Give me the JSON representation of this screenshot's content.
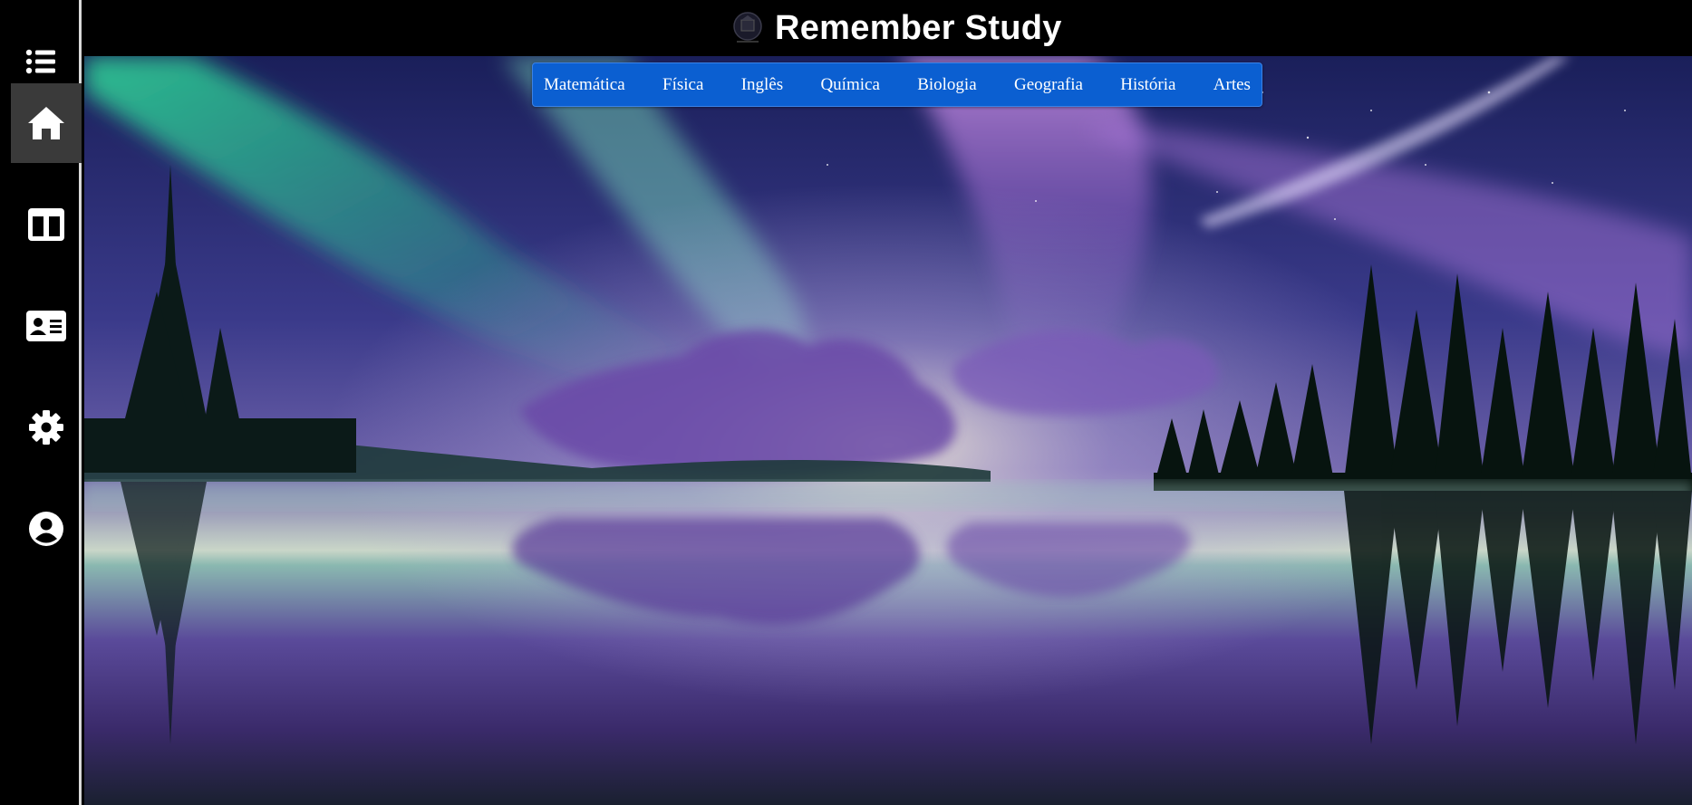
{
  "app": {
    "title": "Remember Study"
  },
  "sidebar": {
    "toggle_icon": "list-icon",
    "items": [
      {
        "id": "home",
        "icon": "home-icon",
        "active": true
      },
      {
        "id": "dashboard",
        "icon": "columns-icon",
        "active": false
      },
      {
        "id": "profile-card",
        "icon": "id-card-icon",
        "active": false
      },
      {
        "id": "settings",
        "icon": "gear-icon",
        "active": false
      },
      {
        "id": "account",
        "icon": "user-circle-icon",
        "active": false
      }
    ]
  },
  "subjects": {
    "items": [
      {
        "label": "Matemática"
      },
      {
        "label": "Física"
      },
      {
        "label": "Inglês"
      },
      {
        "label": "Química"
      },
      {
        "label": "Biologia"
      },
      {
        "label": "Geografia"
      },
      {
        "label": "História"
      },
      {
        "label": "Artes"
      }
    ]
  },
  "colors": {
    "menu_bg": "#0b5fd1",
    "sidebar_bg": "#000000",
    "active_item_bg": "#3a3a3a",
    "header_bg": "#000000"
  }
}
